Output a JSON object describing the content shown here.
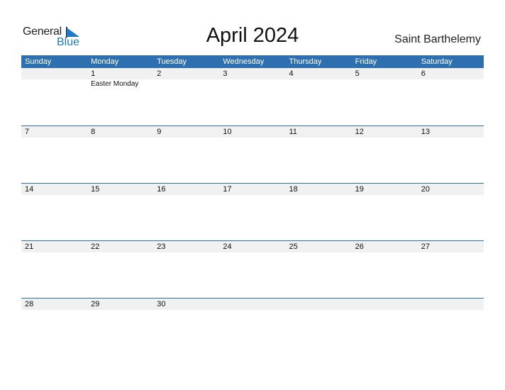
{
  "logo": {
    "line1": "General",
    "line2": "Blue",
    "accent_color": "#1f7bc8"
  },
  "title": "April 2024",
  "country": "Saint Barthelemy",
  "header_color": "#2e6faf",
  "weekdays": [
    "Sunday",
    "Monday",
    "Tuesday",
    "Wednesday",
    "Thursday",
    "Friday",
    "Saturday"
  ],
  "weeks": [
    [
      {
        "day": ""
      },
      {
        "day": "1",
        "holiday": "Easter Monday"
      },
      {
        "day": "2"
      },
      {
        "day": "3"
      },
      {
        "day": "4"
      },
      {
        "day": "5"
      },
      {
        "day": "6"
      }
    ],
    [
      {
        "day": "7"
      },
      {
        "day": "8"
      },
      {
        "day": "9"
      },
      {
        "day": "10"
      },
      {
        "day": "11"
      },
      {
        "day": "12"
      },
      {
        "day": "13"
      }
    ],
    [
      {
        "day": "14"
      },
      {
        "day": "15"
      },
      {
        "day": "16"
      },
      {
        "day": "17"
      },
      {
        "day": "18"
      },
      {
        "day": "19"
      },
      {
        "day": "20"
      }
    ],
    [
      {
        "day": "21"
      },
      {
        "day": "22"
      },
      {
        "day": "23"
      },
      {
        "day": "24"
      },
      {
        "day": "25"
      },
      {
        "day": "26"
      },
      {
        "day": "27"
      }
    ],
    [
      {
        "day": "28"
      },
      {
        "day": "29"
      },
      {
        "day": "30"
      },
      {
        "day": ""
      },
      {
        "day": ""
      },
      {
        "day": ""
      },
      {
        "day": ""
      }
    ]
  ]
}
